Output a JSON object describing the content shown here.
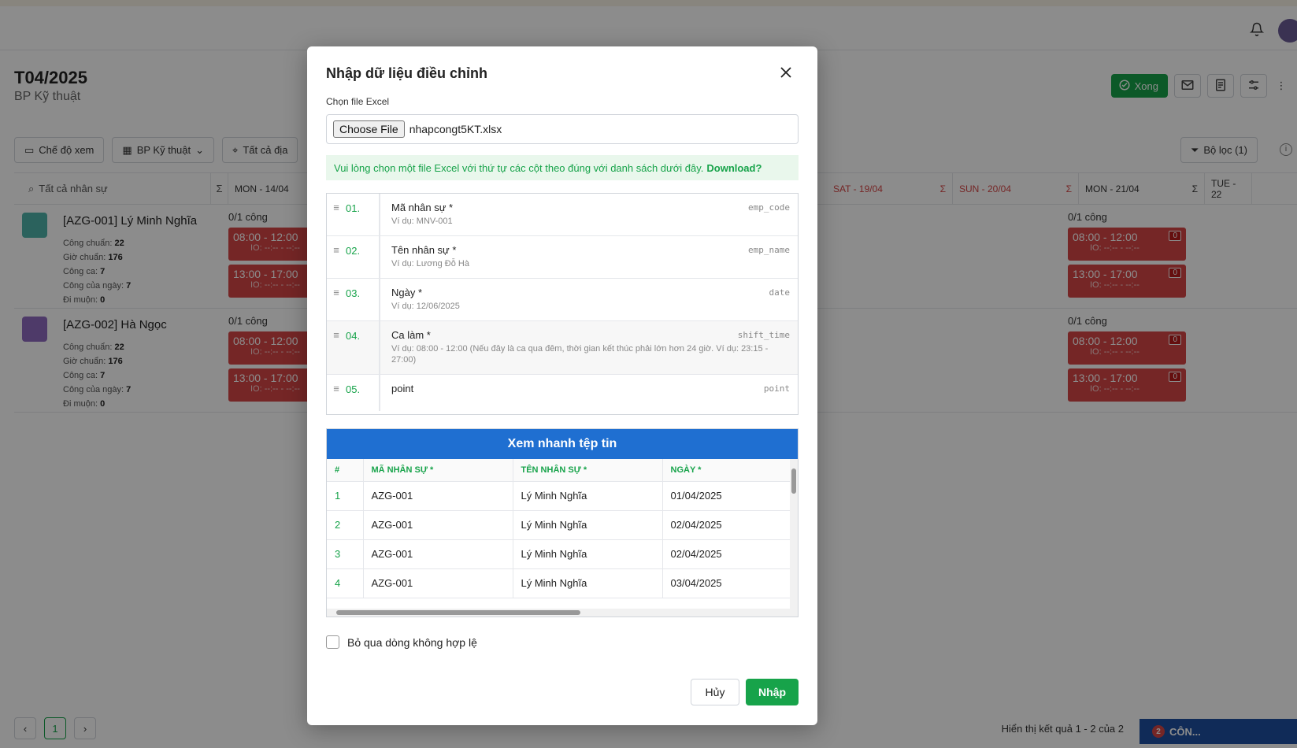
{
  "app": {
    "period_title": "T04/2025",
    "department": "BP Kỹ thuật",
    "done_label": "Xong",
    "toolbar": {
      "view_mode": "Chế độ xem",
      "department": "BP Kỹ thuật",
      "location": "Tất cả địa"
    },
    "filter_label": "Bộ lọc (1)",
    "search_placeholder": "Tất cả nhân sự",
    "days": [
      {
        "label": "MON - 14/04",
        "weekend": false
      },
      {
        "label": "SAT - 19/04",
        "weekend": true
      },
      {
        "label": "SUN - 20/04",
        "weekend": true
      },
      {
        "label": "MON - 21/04",
        "weekend": false
      },
      {
        "label": "TUE - 22",
        "weekend": false
      }
    ],
    "employees": [
      {
        "name": "[AZG-001] Lý Minh Nghĩa",
        "avatar_color": "#4fb3a9",
        "stats": [
          {
            "label": "Công chuẩn:",
            "value": "22"
          },
          {
            "label": "Giờ chuẩn:",
            "value": "176"
          },
          {
            "label": "Công ca:",
            "value": "7"
          },
          {
            "label": "Công của ngày:",
            "value": "7"
          },
          {
            "label": "Đi muộn:",
            "value": "0"
          }
        ],
        "count": "0/1 công",
        "shifts": [
          "08:00 - 12:00",
          "13:00 - 17:00"
        ]
      },
      {
        "name": "[AZG-002] Hà Ngọc",
        "avatar_color": "#8e6bbf",
        "stats": [
          {
            "label": "Công chuẩn:",
            "value": "22"
          },
          {
            "label": "Giờ chuẩn:",
            "value": "176"
          },
          {
            "label": "Công ca:",
            "value": "7"
          },
          {
            "label": "Công của ngày:",
            "value": "7"
          },
          {
            "label": "Đi muộn:",
            "value": "0"
          }
        ],
        "count": "0/1 công",
        "shifts": [
          "08:00 - 12:00",
          "13:00 - 17:00"
        ]
      }
    ],
    "io_placeholder": "IO: --:-- - --:--",
    "zero_badge": "0",
    "current_page": "1",
    "result_text": "Hiển thị kết quả 1 - 2 của 2",
    "chat_badge": "2",
    "chat_label": "CÔN..."
  },
  "modal": {
    "title": "Nhập dữ liệu điều chỉnh",
    "file_label": "Chọn file Excel",
    "choose_button": "Choose File",
    "file_name": "nhapcongt5KT.xlsx",
    "notice": "Vui lòng chọn một file Excel với thứ tự các cột theo đúng với danh sách dưới đây.",
    "download_link": "Download?",
    "columns": [
      {
        "index": "01.",
        "name": "Mã nhân sự *",
        "example": "Ví dụ: MNV-001",
        "key": "emp_code"
      },
      {
        "index": "02.",
        "name": "Tên nhân sự *",
        "example": "Ví dụ: Lương Đỗ Hà",
        "key": "emp_name"
      },
      {
        "index": "03.",
        "name": "Ngày *",
        "example": "Ví dụ: 12/06/2025",
        "key": "date"
      },
      {
        "index": "04.",
        "name": "Ca làm *",
        "example": "Ví dụ: 08:00 - 12:00 (Nếu đây là ca qua đêm, thời gian kết thúc phải lớn hơn 24 giờ. Ví dụ: 23:15 - 27:00)",
        "key": "shift_time"
      },
      {
        "index": "05.",
        "name": "point",
        "example": "",
        "key": "point"
      }
    ],
    "preview_title": "Xem nhanh tệp tin",
    "preview_headers": [
      "#",
      "MÃ NHÂN SỰ *",
      "TÊN NHÂN SỰ *",
      "NGÀY *"
    ],
    "preview_rows": [
      [
        "1",
        "AZG-001",
        "Lý Minh Nghĩa",
        "01/04/2025"
      ],
      [
        "2",
        "AZG-001",
        "Lý Minh Nghĩa",
        "02/04/2025"
      ],
      [
        "3",
        "AZG-001",
        "Lý Minh Nghĩa",
        "02/04/2025"
      ],
      [
        "4",
        "AZG-001",
        "Lý Minh Nghĩa",
        "03/04/2025"
      ]
    ],
    "skip_invalid_label": "Bỏ qua dòng không hợp lệ",
    "cancel_label": "Hủy",
    "import_label": "Nhập"
  }
}
